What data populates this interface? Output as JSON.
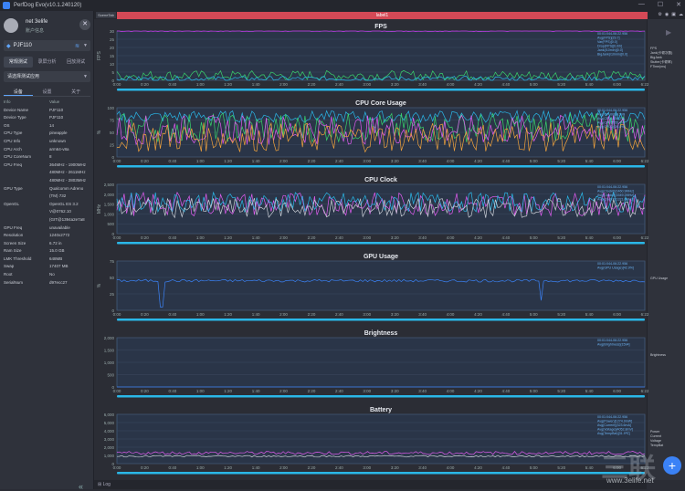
{
  "window": {
    "title": "PerfDog Evo(v10.1.240120)"
  },
  "sidebar": {
    "user_name": "net 3elife",
    "account_label": "账户信息",
    "device_name": "PJF110",
    "mode_tabs": [
      "常规测试",
      "录屏分析",
      "回放测试"
    ],
    "app_select": "请选择测试应用",
    "sub_tabs": [
      "设备",
      "设置",
      "关于"
    ],
    "info_header": {
      "key": "Info",
      "value": "Value"
    },
    "info_rows": [
      {
        "k": "Device Name",
        "v": "PJF110"
      },
      {
        "k": "Device Type",
        "v": "PJF110"
      },
      {
        "k": "OS",
        "v": "14"
      },
      {
        "k": "CPU Type",
        "v": "pineapple"
      },
      {
        "k": "CPU Info",
        "v": "unknown"
      },
      {
        "k": "CPU Arch",
        "v": "arm64-v8a"
      },
      {
        "k": "CPU CoreNum",
        "v": "8"
      },
      {
        "k": "CPU Freq",
        "v": "364MHz - 1900MHz"
      },
      {
        "k": "",
        "v": "480MHz - 2611MHz"
      },
      {
        "k": "",
        "v": "480MHz - 2803MHz"
      },
      {
        "k": "GPU Type",
        "v": "Qualcomm Adreno (TM) 732"
      },
      {
        "k": "OpenGL",
        "v": "OpenGL ES 3.2 V@0762.10 (GIT@1394a2e7a8"
      },
      {
        "k": "GPU Freq",
        "v": "unavailable"
      },
      {
        "k": "Resolution",
        "v": "1240x2772"
      },
      {
        "k": "Screen Size",
        "v": "6.72 in"
      },
      {
        "k": "Ram Size",
        "v": "15.0 GB"
      },
      {
        "k": "LMK Threshold",
        "v": "648MB"
      },
      {
        "k": "Swap",
        "v": "17407 MB"
      },
      {
        "k": "Root",
        "v": "No"
      },
      {
        "k": "SerialNum",
        "v": "d97ecc27"
      }
    ]
  },
  "tabs": {
    "scene": "SceneTab",
    "label": "label1"
  },
  "statusbar": {
    "log": "Log"
  },
  "watermark": {
    "big": "三联",
    "url": "www.3elife.net"
  },
  "x_ticks": [
    "0:00",
    "0:20",
    "0:40",
    "1:00",
    "1:20",
    "1:40",
    "2:00",
    "2:20",
    "2:40",
    "3:00",
    "3:20",
    "3:40",
    "4:00",
    "4:20",
    "4:40",
    "5:00",
    "5:20",
    "5:40",
    "6:00",
    "6:22"
  ],
  "chart_data": [
    {
      "type": "line",
      "title": "FPS",
      "ylabel": "FPS",
      "ylim": [
        0,
        30
      ],
      "yticks": [
        "0",
        "5",
        "10",
        "15",
        "20",
        "25",
        "30"
      ],
      "grid": true,
      "legend_position": "right",
      "legend": [
        "FPS",
        "Jank(卡顿次数)",
        "BigJank",
        "Stutter(卡顿率)",
        "FTime(ms)"
      ],
      "series": [
        {
          "name": "FPS",
          "color": "#c83cf0",
          "mean": 30,
          "noise": 0.4,
          "values": []
        },
        {
          "name": "Jank",
          "color": "#39d36b",
          "mean": 3,
          "noise": 3,
          "values": []
        },
        {
          "name": "BigJank",
          "color": "#2ab7e8",
          "mean": 1,
          "noise": 1.5,
          "values": []
        }
      ],
      "annotations": [
        "00:01:044-06:22.956",
        "Avg(FPS)[29.7]",
        "Var(FPS)[0.0]",
        "Drop(FPS)[0.0/h]",
        "Jank(/10min)[0.0]",
        "BigJank(/10min)[0.0]"
      ]
    },
    {
      "type": "line",
      "title": "CPU Core Usage",
      "ylabel": "%",
      "ylim": [
        0,
        100
      ],
      "yticks": [
        "0",
        "25",
        "50",
        "75",
        "100"
      ],
      "grid": true,
      "legend_position": "right",
      "series": [
        {
          "name": "CPU0",
          "color": "#2ab7e8",
          "mean": 82,
          "noise": 12
        },
        {
          "name": "CPU1",
          "color": "#39d36b",
          "mean": 60,
          "noise": 30
        },
        {
          "name": "CPU2",
          "color": "#e05cf0",
          "mean": 55,
          "noise": 30
        },
        {
          "name": "CPU3",
          "color": "#f0a23c",
          "mean": 40,
          "noise": 30
        }
      ],
      "annotations": [
        "00:01:044-06:22.956",
        "Avg(CPU0)[88.5%]",
        "Avg(CPU1)[56.2%]",
        "Avg(CPU2)[55.4%]",
        "Avg(CPU3)[39.8%]"
      ]
    },
    {
      "type": "line",
      "title": "CPU Clock",
      "ylabel": "MHz",
      "ylim": [
        0,
        2500
      ],
      "yticks": [
        "0",
        "500",
        "1,000",
        "1,500",
        "2,000",
        "2,500"
      ],
      "grid": true,
      "legend_position": "right",
      "series": [
        {
          "name": "CPU0 Clock",
          "color": "#e05cf0",
          "mean": 1500,
          "noise": 600
        },
        {
          "name": "CPU3 Clock",
          "color": "#2ab7e8",
          "mean": 1600,
          "noise": 500
        },
        {
          "name": "CPU7 Clock",
          "color": "#c8ccd4",
          "mean": 1300,
          "noise": 500
        }
      ],
      "annotations": [
        "00:01:044-06:22.956",
        "Avg(Clock0)[1460.9MHz]",
        "Avg(Clock3)[1549.2MHz]",
        "Avg(Clock7)[1321.0MHz]"
      ]
    },
    {
      "type": "line",
      "title": "GPU Usage",
      "ylabel": "%",
      "ylim": [
        0,
        75
      ],
      "yticks": [
        "0",
        "25",
        "50",
        "75"
      ],
      "grid": true,
      "legend_position": "right",
      "legend": [
        "GPU Usage"
      ],
      "series": [
        {
          "name": "GPU Usage",
          "color": "#3b82f6",
          "mean": 45,
          "noise": 2
        }
      ],
      "annotations": [
        "00:01:044-06:22.956",
        "Avg(GPU Usage)[42.9%]"
      ]
    },
    {
      "type": "line",
      "title": "Brightness",
      "ylabel": "",
      "ylim": [
        0,
        2000
      ],
      "yticks": [
        "0",
        "500",
        "1,000",
        "1,500",
        "2,000"
      ],
      "grid": true,
      "legend_position": "right",
      "legend": [
        "Brightness"
      ],
      "series": [
        {
          "name": "Brightness",
          "color": "#3b82f6",
          "mean": 0,
          "noise": 0
        }
      ],
      "annotations": [
        "00:01:044-06:22.956",
        "Avg(Brightness)[1594]"
      ]
    },
    {
      "type": "line",
      "title": "Battery",
      "ylabel": "",
      "ylim": [
        0,
        6000
      ],
      "yticks": [
        "0",
        "1,000",
        "2,000",
        "3,000",
        "4,000",
        "5,000",
        "6,000"
      ],
      "grid": true,
      "legend_position": "right",
      "legend": [
        "Power",
        "Current",
        "Voltage",
        "TempBat"
      ],
      "series": [
        {
          "name": "Power",
          "color": "#e05cf0",
          "mean": 1300,
          "noise": 200
        },
        {
          "name": "Current",
          "color": "#c8ccd4",
          "mean": 900,
          "noise": 100
        }
      ],
      "annotations": [
        "00:01:044-06:22.956",
        "Avg(Power)[1274.9mW]",
        "Avg(Current)[323.6mA]",
        "Avg(Voltage)[4052.8mV]",
        "Avg(TempBat)[31.9℃]"
      ]
    }
  ]
}
